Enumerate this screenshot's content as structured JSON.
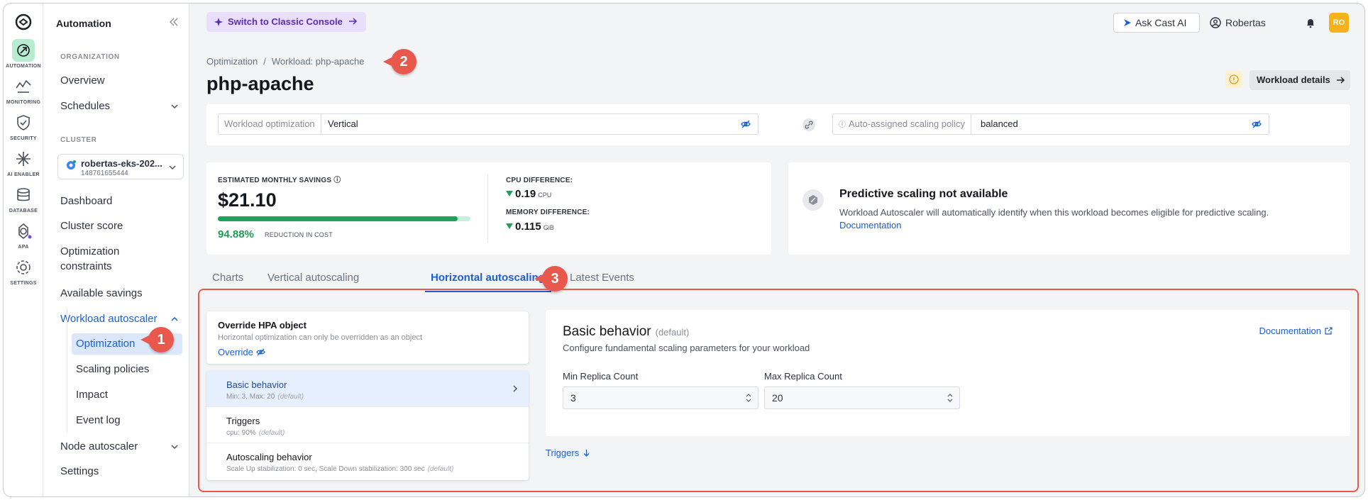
{
  "rail": {
    "items": [
      {
        "label": "AUTOMATION",
        "icon": "automation-icon"
      },
      {
        "label": "MONITORING",
        "icon": "monitoring-icon"
      },
      {
        "label": "SECURITY",
        "icon": "security-icon"
      },
      {
        "label": "AI ENABLER",
        "icon": "ai-enabler-icon"
      },
      {
        "label": "DATABASE",
        "icon": "database-icon"
      },
      {
        "label": "APA",
        "icon": "apa-icon"
      },
      {
        "label": "SETTINGS",
        "icon": "settings-icon"
      }
    ]
  },
  "sidebar": {
    "title": "Automation",
    "org_section": "ORGANIZATION",
    "overview": "Overview",
    "schedules": "Schedules",
    "cluster_section": "CLUSTER",
    "cluster_name": "robertas-eks-202...",
    "cluster_id": "148761655444",
    "dashboard": "Dashboard",
    "cluster_score": "Cluster score",
    "optimization_constraints_1": "Optimization",
    "optimization_constraints_2": "constraints",
    "available_savings": "Available savings",
    "workload_autoscaler": "Workload autoscaler",
    "sub": [
      "Optimization",
      "Scaling policies",
      "Impact",
      "Event log"
    ],
    "node_autoscaler": "Node autoscaler",
    "settings": "Settings"
  },
  "topbar": {
    "classic_console": "Switch to Classic Console",
    "ask": "Ask Cast AI",
    "user": "Robertas",
    "avatar": "RO"
  },
  "breadcrumb": {
    "root": "Optimization",
    "sep": "/",
    "current": "Workload: php-apache"
  },
  "page_title": "php-apache",
  "workload_details": "Workload details",
  "optimization": {
    "workload_label": "Workload optimization",
    "workload_value": "Vertical",
    "policy_label": "Auto-assigned scaling policy",
    "policy_value": "balanced"
  },
  "savings": {
    "label": "ESTIMATED MONTHLY SAVINGS",
    "amount": "$21.10",
    "percent": "94.88%",
    "percent_value": 0.9488,
    "percent_label": "REDUCTION IN COST",
    "cpu_label": "CPU DIFFERENCE:",
    "cpu_value": "0.19",
    "cpu_unit": "CPU",
    "mem_label": "MEMORY DIFFERENCE:",
    "mem_value": "0.115",
    "mem_unit": "GiB"
  },
  "predictive": {
    "title": "Predictive scaling not available",
    "text": "Workload Autoscaler will automatically identify when this workload becomes eligible for predictive scaling.",
    "link": "Documentation"
  },
  "tabs": [
    "Charts",
    "Vertical autoscaling",
    "Horizontal autoscaling",
    "Latest Events"
  ],
  "override": {
    "title": "Override HPA object",
    "text": "Horizontal optimization can only be overridden as an object",
    "link": "Override"
  },
  "nav": [
    {
      "title": "Basic behavior",
      "sub": "Min: 3, Max: 20",
      "tag": "(default)"
    },
    {
      "title": "Triggers",
      "sub": "cpu: 90%",
      "tag": "(default)"
    },
    {
      "title": "Autoscaling behavior",
      "sub": "Scale Up stabilization: 0 sec, Scale Down stabilization: 300 sec",
      "tag": "(default)"
    }
  ],
  "basic": {
    "title": "Basic behavior",
    "tag": "(default)",
    "subtitle": "Configure fundamental scaling parameters for your workload",
    "doc_link": "Documentation",
    "min_label": "Min Replica Count",
    "min_value": "3",
    "max_label": "Max Replica Count",
    "max_value": "20"
  },
  "triggers_link": "Triggers",
  "callouts": [
    "1",
    "2",
    "3"
  ],
  "colors": {
    "accent": "#1d5fcf",
    "callout": "#e8584d",
    "success": "#1fa35a",
    "avatar": "#f5b21b"
  }
}
